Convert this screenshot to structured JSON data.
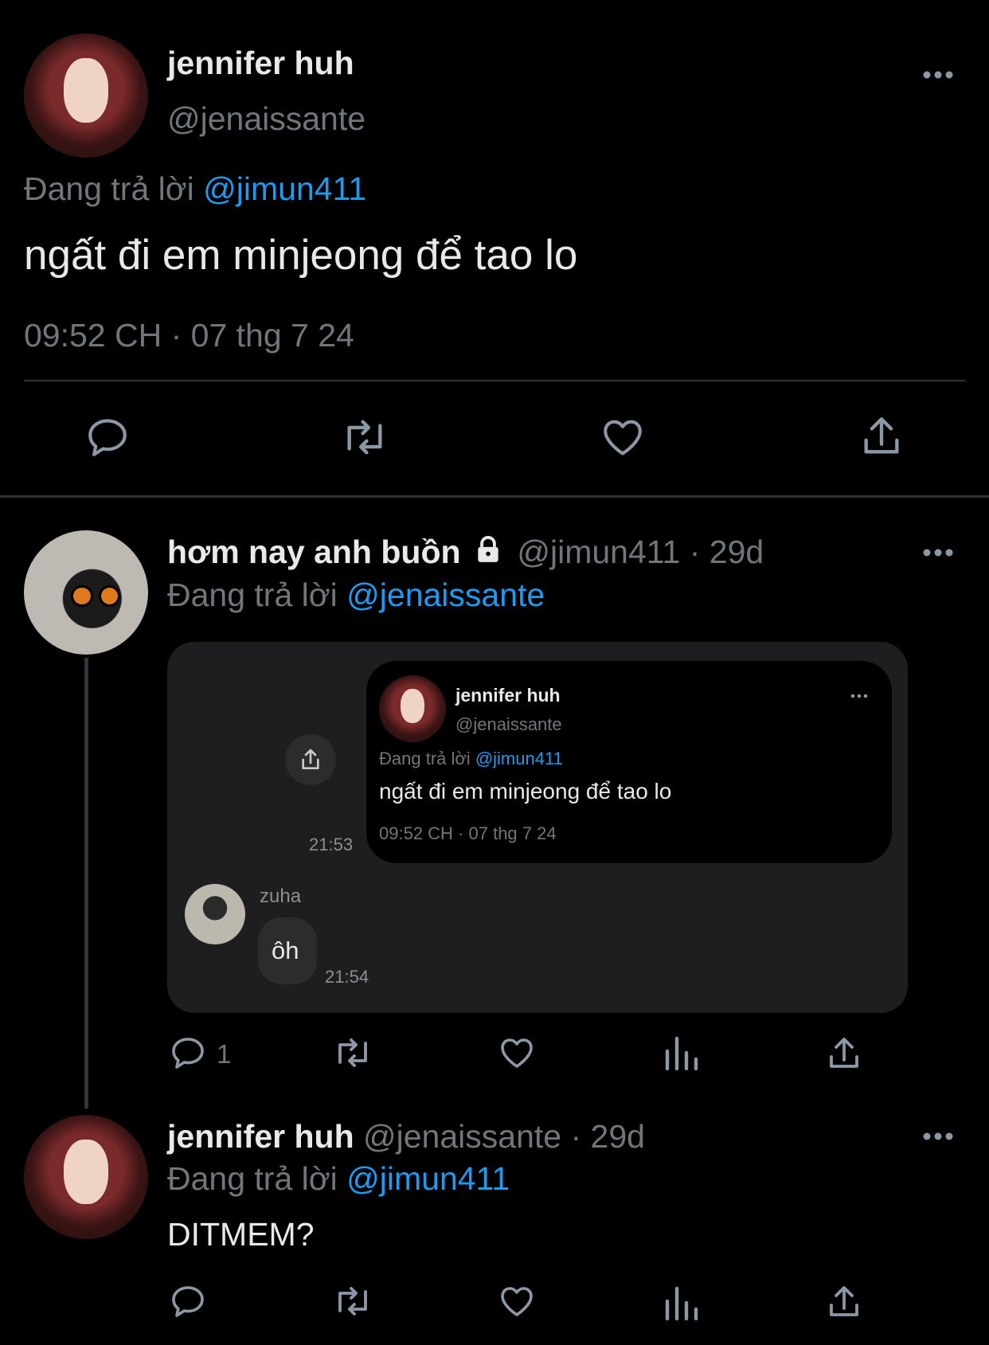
{
  "main_tweet": {
    "display_name": "jennifer huh",
    "handle": "@jenaissante",
    "reply_prefix": "Đang trả lời",
    "reply_to": "@jimun411",
    "text": "ngất đi em minjeong để tao lo",
    "timestamp": "09:52 CH · 07 thg 7 24"
  },
  "reply1": {
    "display_name": "hơm nay anh buồn",
    "handle": "@jimun411",
    "age": "· 29d",
    "reply_prefix": "Đang trả lời",
    "reply_to": "@jenaissante",
    "reply_count": "1",
    "embed": {
      "quoted": {
        "display_name": "jennifer huh",
        "handle": "@jenaissante",
        "reply_prefix": "Đang trả lời",
        "reply_to": "@jimun411",
        "text": "ngất đi em minjeong để tao lo",
        "timestamp": "09:52 CH · 07 thg 7 24"
      },
      "sent_time": "21:53",
      "chat_user": "zuha",
      "chat_message": "ôh",
      "chat_time": "21:54"
    }
  },
  "reply2": {
    "display_name": "jennifer huh",
    "handle": "@jenaissante",
    "age": "· 29d",
    "reply_prefix": "Đang trả lời",
    "reply_to": "@jimun411",
    "text": "DITMEM?"
  },
  "colors": {
    "background": "#000000",
    "text": "#e7e9ea",
    "muted": "#71767b",
    "link": "#1d9bf0"
  }
}
